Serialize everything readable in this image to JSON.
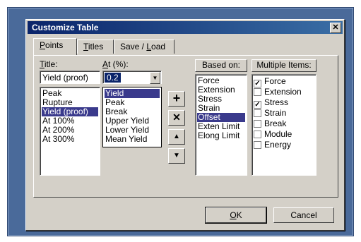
{
  "window": {
    "title": "Customize Table",
    "close_glyph": "✕"
  },
  "tabs": [
    {
      "hotkey": "P",
      "rest": "oints",
      "active": true
    },
    {
      "hotkey": "T",
      "rest": "itles",
      "active": false
    },
    {
      "pre": "Save / ",
      "hotkey": "L",
      "rest": "oad",
      "active": false
    }
  ],
  "title_field": {
    "label_hotkey": "T",
    "label_rest": "itle:",
    "value": "Yield (proof)"
  },
  "title_list": [
    "Peak",
    "Rupture",
    "Yield (proof)",
    "At 100%",
    "At 200%",
    "At 300%"
  ],
  "title_selected": "Yield (proof)",
  "at_field": {
    "label_hotkey": "A",
    "label_rest": "t (%):",
    "value": "0.2"
  },
  "at_popup": [
    "Yield",
    "Peak",
    "Break",
    "Upper Yield",
    "Lower Yield",
    "Mean Yield"
  ],
  "at_popup_selected": "Yield",
  "action_buttons": {
    "add": "+",
    "remove": "✕",
    "up": "▲",
    "down": "▼"
  },
  "based_on": {
    "header": "Based on:",
    "items": [
      "Force",
      "Extension",
      "Stress",
      "Strain",
      "Offset",
      "Exten Limit",
      "Elong Limit"
    ],
    "selected": "Offset"
  },
  "multiple_items": {
    "header": "Multiple Items:",
    "items": [
      {
        "label": "Force",
        "checked": true
      },
      {
        "label": "Extension",
        "checked": false
      },
      {
        "label": "Stress",
        "checked": true
      },
      {
        "label": "Strain",
        "checked": false
      },
      {
        "label": "Break",
        "checked": false
      },
      {
        "label": "Module",
        "checked": false
      },
      {
        "label": "Energy",
        "checked": false
      }
    ]
  },
  "footer": {
    "ok_hotkey": "O",
    "ok_rest": "K",
    "cancel": "Cancel"
  },
  "colors": {
    "titlebar": "#0a246a",
    "selection": "#3a3a8c",
    "dialog_bg": "#d4d0c8"
  }
}
